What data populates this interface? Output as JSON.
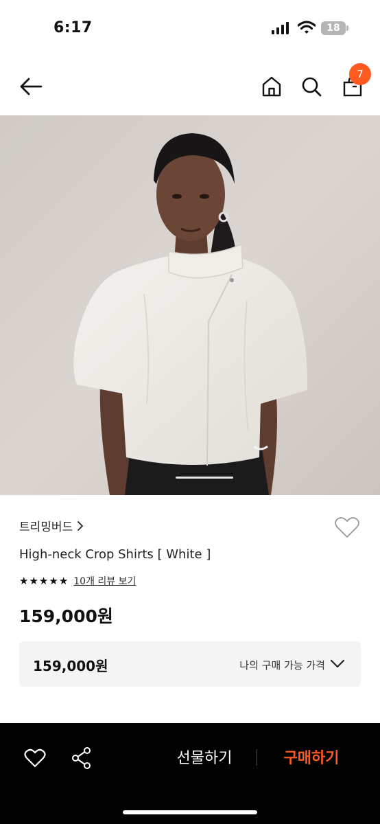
{
  "status_bar": {
    "time": "6:17",
    "battery": "18",
    "icons": [
      "signal-icon",
      "wifi-icon",
      "battery-icon"
    ]
  },
  "header": {
    "icons": [
      "back-arrow-icon",
      "home-icon",
      "search-icon",
      "shopping-bag-icon"
    ],
    "bag_count": "7",
    "accent_color": "#ff5a1f"
  },
  "product": {
    "brand": "트리밍버드",
    "name": "High-neck Crop Shirts [ White ]",
    "rating_stars": 5,
    "review_link": "10개 리뷰 보기",
    "price": "159,000원"
  },
  "my_price": {
    "value": "159,000원",
    "label": "나의 구매 가능 가격"
  },
  "bottom_bar": {
    "gift_label": "선물하기",
    "buy_label": "구매하기",
    "buy_color": "#ff5a1f",
    "icons": [
      "heart-icon",
      "share-icon"
    ]
  }
}
